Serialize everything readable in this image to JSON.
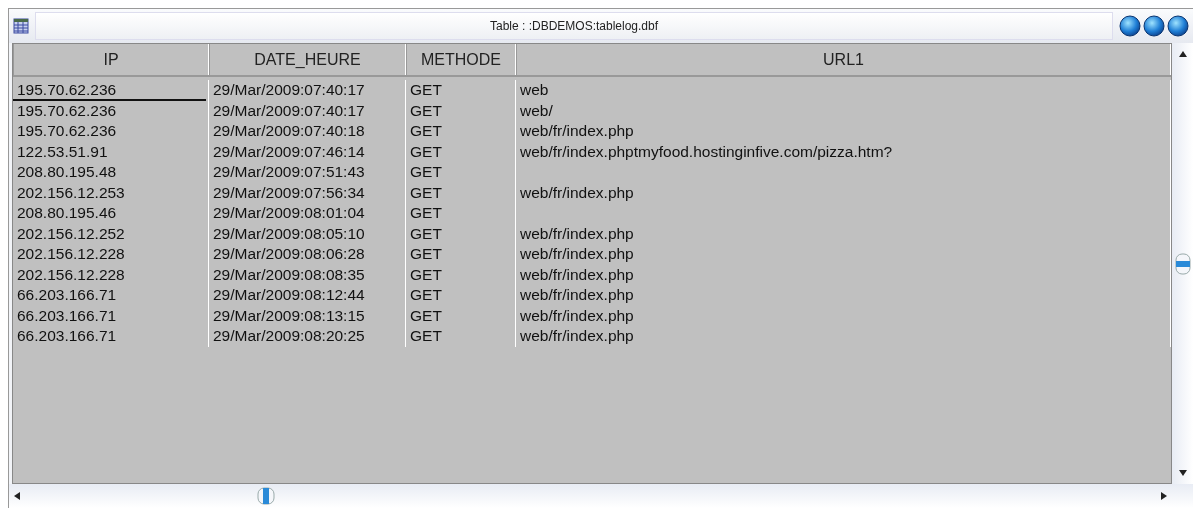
{
  "window": {
    "title": "Table : :DBDEMOS:tablelog.dbf"
  },
  "table": {
    "columns": [
      "IP",
      "DATE_HEURE",
      "METHODE",
      "URL1"
    ],
    "rows": [
      {
        "cells": [
          "195.70.62.236",
          "29/Mar/2009:07:40:17",
          "GET",
          "web"
        ],
        "selected": true
      },
      {
        "cells": [
          "195.70.62.236",
          "29/Mar/2009:07:40:17",
          "GET",
          "web/"
        ],
        "selected": false
      },
      {
        "cells": [
          "195.70.62.236",
          "29/Mar/2009:07:40:18",
          "GET",
          "web/fr/index.php"
        ],
        "selected": false
      },
      {
        "cells": [
          "122.53.51.91",
          "29/Mar/2009:07:46:14",
          "GET",
          "web/fr/index.phptmyfood.hostinginfive.com/pizza.htm?"
        ],
        "selected": false
      },
      {
        "cells": [
          "208.80.195.48",
          "29/Mar/2009:07:51:43",
          "GET",
          ""
        ],
        "selected": false
      },
      {
        "cells": [
          "202.156.12.253",
          "29/Mar/2009:07:56:34",
          "GET",
          "web/fr/index.php"
        ],
        "selected": false
      },
      {
        "cells": [
          "208.80.195.46",
          "29/Mar/2009:08:01:04",
          "GET",
          ""
        ],
        "selected": false
      },
      {
        "cells": [
          "202.156.12.252",
          "29/Mar/2009:08:05:10",
          "GET",
          "web/fr/index.php"
        ],
        "selected": false
      },
      {
        "cells": [
          "202.156.12.228",
          "29/Mar/2009:08:06:28",
          "GET",
          "web/fr/index.php"
        ],
        "selected": false
      },
      {
        "cells": [
          "202.156.12.228",
          "29/Mar/2009:08:08:35",
          "GET",
          "web/fr/index.php"
        ],
        "selected": false
      },
      {
        "cells": [
          "66.203.166.71",
          "29/Mar/2009:08:12:44",
          "GET",
          "web/fr/index.php"
        ],
        "selected": false
      },
      {
        "cells": [
          "66.203.166.71",
          "29/Mar/2009:08:13:15",
          "GET",
          "web/fr/index.php"
        ],
        "selected": false
      },
      {
        "cells": [
          "66.203.166.71",
          "29/Mar/2009:08:20:25",
          "GET",
          "web/fr/index.php"
        ],
        "selected": false
      }
    ]
  }
}
